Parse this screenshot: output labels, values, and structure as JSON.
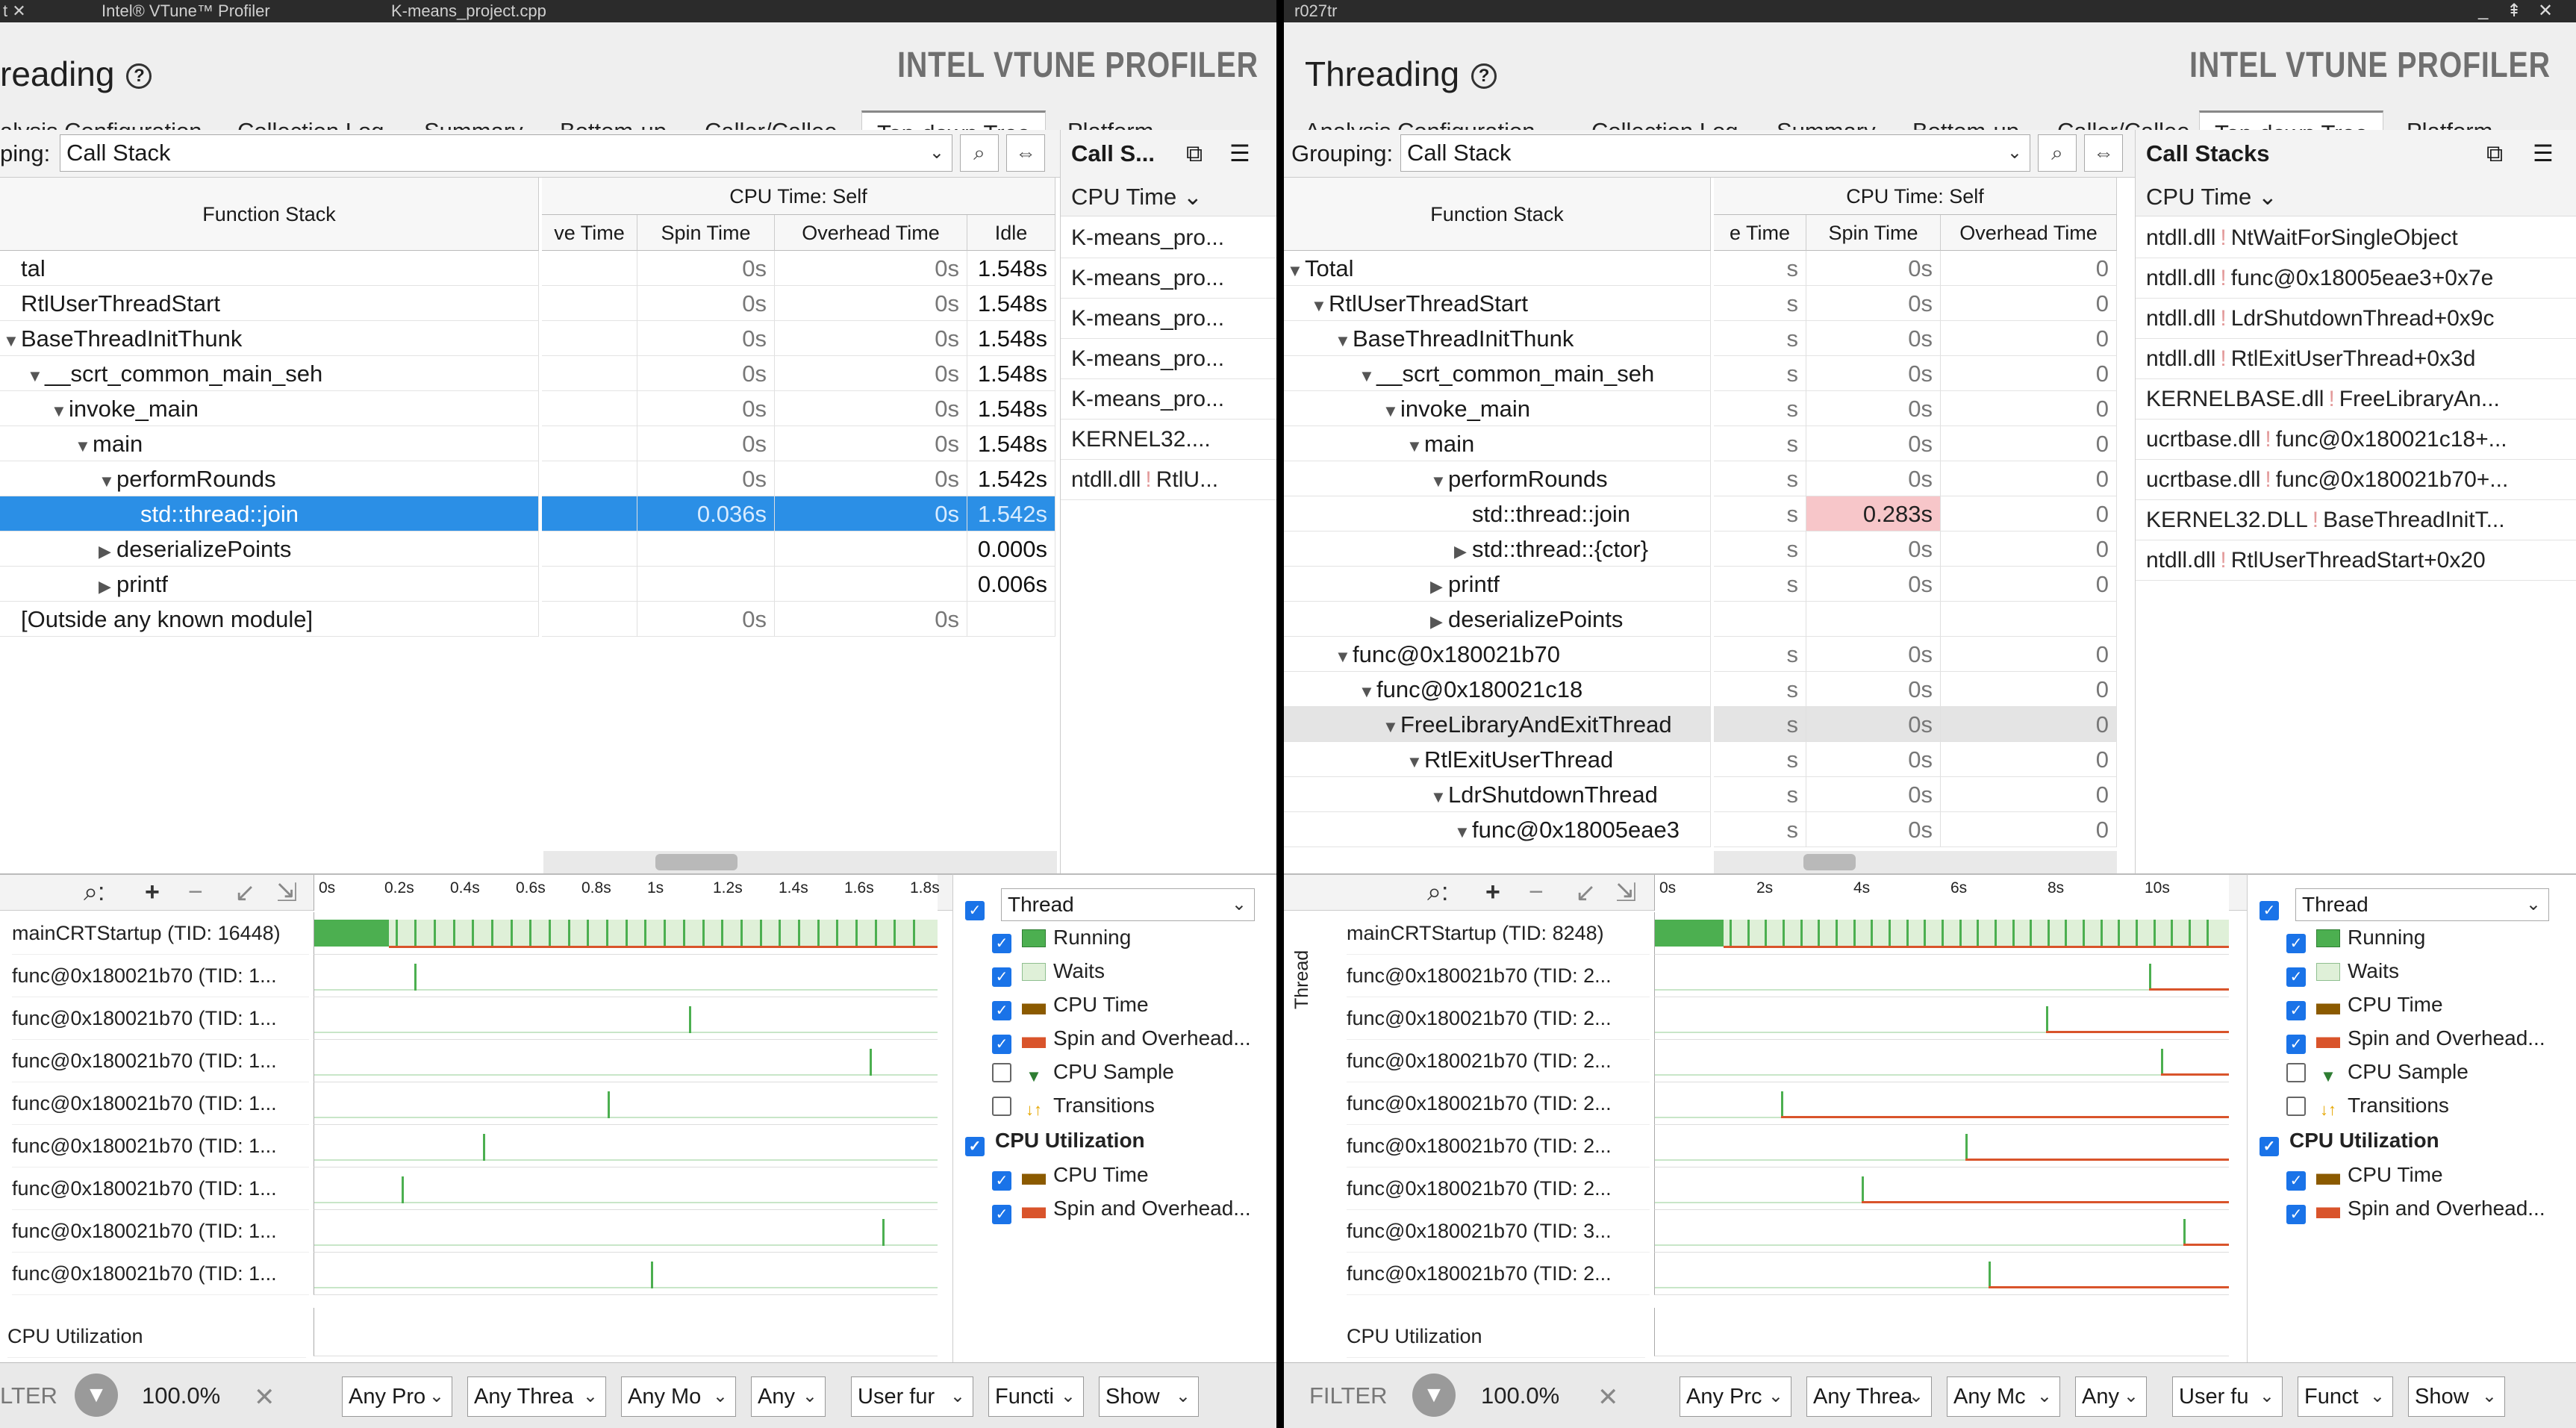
{
  "left": {
    "titlebar": {
      "left_text": "t ✕",
      "tab1": "Intel® VTune™ Profiler",
      "tab2": "K-means_project.cpp"
    },
    "title": "reading",
    "brand": "INTEL VTUNE PROFILER",
    "tabs": [
      "alysis Configuration",
      "Collection Log",
      "Summary",
      "Bottom-up",
      "Caller/Callee",
      "Top-down Tree",
      "Platform"
    ],
    "grouping_label": "ping:",
    "grouping_value": "Call Stack",
    "columns": {
      "function_stack": "Function Stack",
      "cpu_self": "CPU Time: Self",
      "wait_time": "ve Time",
      "spin": "Spin Time",
      "overhead": "Overhead Time",
      "idle": "Idle"
    },
    "rows": [
      {
        "name": "tal",
        "indent": 0,
        "tri": "",
        "wait": "",
        "spin": "0s",
        "overhead": "0s",
        "idle": "1.548s"
      },
      {
        "name": "RtlUserThreadStart",
        "indent": 0,
        "tri": "",
        "wait": "",
        "spin": "0s",
        "overhead": "0s",
        "idle": "1.548s"
      },
      {
        "name": "BaseThreadInitThunk",
        "indent": 0,
        "tri": "▼",
        "wait": "",
        "spin": "0s",
        "overhead": "0s",
        "idle": "1.548s"
      },
      {
        "name": "__scrt_common_main_seh",
        "indent": 1,
        "tri": "▼",
        "wait": "",
        "spin": "0s",
        "overhead": "0s",
        "idle": "1.548s"
      },
      {
        "name": "invoke_main",
        "indent": 2,
        "tri": "▼",
        "wait": "",
        "spin": "0s",
        "overhead": "0s",
        "idle": "1.548s"
      },
      {
        "name": "main",
        "indent": 3,
        "tri": "▼",
        "wait": "",
        "spin": "0s",
        "overhead": "0s",
        "idle": "1.548s"
      },
      {
        "name": "performRounds",
        "indent": 4,
        "tri": "▼",
        "wait": "",
        "spin": "0s",
        "overhead": "0s",
        "idle": "1.542s"
      },
      {
        "name": "std::thread::join",
        "indent": 5,
        "tri": "",
        "wait": "",
        "spin": "0.036s",
        "overhead": "0s",
        "idle": "1.542s",
        "selected": true
      },
      {
        "name": "deserializePoints",
        "indent": 4,
        "tri": "▶",
        "wait": "",
        "spin": "",
        "overhead": "",
        "idle": "0.000s"
      },
      {
        "name": "printf",
        "indent": 4,
        "tri": "▶",
        "wait": "",
        "spin": "",
        "overhead": "",
        "idle": "0.006s"
      },
      {
        "name": "[Outside any known module]",
        "indent": 0,
        "tri": "",
        "wait": "",
        "spin": "0s",
        "overhead": "0s",
        "idle": ""
      }
    ],
    "callstacks": {
      "title": "Call S...",
      "sub": "CPU Time",
      "items": [
        {
          "mod": "K-means_pro...",
          "fn": ""
        },
        {
          "mod": "K-means_pro...",
          "fn": ""
        },
        {
          "mod": "K-means_pro...",
          "fn": ""
        },
        {
          "mod": "K-means_pro...",
          "fn": ""
        },
        {
          "mod": "K-means_pro...",
          "fn": ""
        },
        {
          "mod": "KERNEL32....",
          "fn": ""
        },
        {
          "mod": "ntdll.dll",
          "fn": "RtlU..."
        }
      ]
    },
    "ticks": [
      "0s",
      "0.2s",
      "0.4s",
      "0.6s",
      "0.8s",
      "1s",
      "1.2s",
      "1.4s",
      "1.6s",
      "1.8s"
    ],
    "threads": [
      {
        "label": "mainCRTStartup (TID: 16448)",
        "mark": 0.0
      },
      {
        "label": "func@0x180021b70 (TID: 1...",
        "mark": 0.16
      },
      {
        "label": "func@0x180021b70 (TID: 1...",
        "mark": 0.6
      },
      {
        "label": "func@0x180021b70 (TID: 1...",
        "mark": 0.89
      },
      {
        "label": "func@0x180021b70 (TID: 1...",
        "mark": 0.47
      },
      {
        "label": "func@0x180021b70 (TID: 1...",
        "mark": 0.27
      },
      {
        "label": "func@0x180021b70 (TID: 1...",
        "mark": 0.14
      },
      {
        "label": "func@0x180021b70 (TID: 1...",
        "mark": 0.91
      },
      {
        "label": "func@0x180021b70 (TID: 1...",
        "mark": 0.54
      }
    ],
    "cpu_util_label": "CPU Utilization",
    "legend": {
      "select": "Thread",
      "items": [
        "Running",
        "Waits",
        "CPU Time",
        "Spin and Overhead...",
        "CPU Sample",
        "Transitions"
      ],
      "section": "CPU Utilization",
      "section_items": [
        "CPU Time",
        "Spin and Overhead..."
      ]
    },
    "filter": {
      "label": "LTER",
      "percent": "100.0%",
      "drops": [
        "Any Pro",
        "Any Threa",
        "Any Mo",
        "Any",
        "User fur",
        "Functi",
        "Show"
      ]
    }
  },
  "right": {
    "titlebar": {
      "left_text": "r027tr"
    },
    "title": "Threading",
    "brand": "INTEL VTUNE PROFILER",
    "tabs": [
      "Analysis Configuration",
      "Collection Log",
      "Summary",
      "Bottom-up",
      "Caller/Callee",
      "Top-down Tree",
      "Platform"
    ],
    "grouping_label": "Grouping:",
    "grouping_value": "Call Stack",
    "columns": {
      "function_stack": "Function Stack",
      "cpu_self": "CPU Time: Self",
      "wait_time": "e Time",
      "spin": "Spin Time",
      "overhead": "Overhead Time"
    },
    "rows": [
      {
        "name": "Total",
        "indent": 0,
        "tri": "▼",
        "wait": "s",
        "spin": "0s",
        "overhead": "0"
      },
      {
        "name": "RtlUserThreadStart",
        "indent": 1,
        "tri": "▼",
        "wait": "s",
        "spin": "0s",
        "overhead": "0"
      },
      {
        "name": "BaseThreadInitThunk",
        "indent": 2,
        "tri": "▼",
        "wait": "s",
        "spin": "0s",
        "overhead": "0"
      },
      {
        "name": "__scrt_common_main_seh",
        "indent": 3,
        "tri": "▼",
        "wait": "s",
        "spin": "0s",
        "overhead": "0"
      },
      {
        "name": "invoke_main",
        "indent": 4,
        "tri": "▼",
        "wait": "s",
        "spin": "0s",
        "overhead": "0"
      },
      {
        "name": "main",
        "indent": 5,
        "tri": "▼",
        "wait": "s",
        "spin": "0s",
        "overhead": "0"
      },
      {
        "name": "performRounds",
        "indent": 6,
        "tri": "▼",
        "wait": "s",
        "spin": "0s",
        "overhead": "0"
      },
      {
        "name": "std::thread::join",
        "indent": 7,
        "tri": "",
        "wait": "s",
        "spin": "0.283s",
        "overhead": "0",
        "pink": true
      },
      {
        "name": "std::thread::{ctor}",
        "indent": 7,
        "tri": "▶",
        "wait": "s",
        "spin": "0s",
        "overhead": "0"
      },
      {
        "name": "printf",
        "indent": 6,
        "tri": "▶",
        "wait": "s",
        "spin": "0s",
        "overhead": "0"
      },
      {
        "name": "deserializePoints",
        "indent": 6,
        "tri": "▶",
        "wait": "",
        "spin": "",
        "overhead": ""
      },
      {
        "name": "func@0x180021b70",
        "indent": 2,
        "tri": "▼",
        "wait": "s",
        "spin": "0s",
        "overhead": "0"
      },
      {
        "name": "func@0x180021c18",
        "indent": 3,
        "tri": "▼",
        "wait": "s",
        "spin": "0s",
        "overhead": "0"
      },
      {
        "name": "FreeLibraryAndExitThread",
        "indent": 4,
        "tri": "▼",
        "wait": "s",
        "spin": "0s",
        "overhead": "0",
        "highlight": true
      },
      {
        "name": "RtlExitUserThread",
        "indent": 5,
        "tri": "▼",
        "wait": "s",
        "spin": "0s",
        "overhead": "0"
      },
      {
        "name": "LdrShutdownThread",
        "indent": 6,
        "tri": "▼",
        "wait": "s",
        "spin": "0s",
        "overhead": "0"
      },
      {
        "name": "func@0x18005eae3",
        "indent": 7,
        "tri": "▼",
        "wait": "s",
        "spin": "0s",
        "overhead": "0"
      }
    ],
    "callstacks": {
      "title": "Call Stacks",
      "sub": "CPU Time",
      "items": [
        {
          "mod": "ntdll.dll",
          "fn": "NtWaitForSingleObject"
        },
        {
          "mod": "ntdll.dll",
          "fn": "func@0x18005eae3+0x7e"
        },
        {
          "mod": "ntdll.dll",
          "fn": "LdrShutdownThread+0x9c"
        },
        {
          "mod": "ntdll.dll",
          "fn": "RtlExitUserThread+0x3d"
        },
        {
          "mod": "KERNELBASE.dll",
          "fn": "FreeLibraryAn..."
        },
        {
          "mod": "ucrtbase.dll",
          "fn": "func@0x180021c18+..."
        },
        {
          "mod": "ucrtbase.dll",
          "fn": "func@0x180021b70+..."
        },
        {
          "mod": "KERNEL32.DLL",
          "fn": "BaseThreadInitT..."
        },
        {
          "mod": "ntdll.dll",
          "fn": "RtlUserThreadStart+0x20"
        }
      ]
    },
    "ticks": [
      "0s",
      "2s",
      "4s",
      "6s",
      "8s",
      "10s"
    ],
    "threads": [
      {
        "label": "mainCRTStartup (TID: 8248)",
        "mark": 0.0
      },
      {
        "label": "func@0x180021b70 (TID: 2...",
        "mark": 0.86
      },
      {
        "label": "func@0x180021b70 (TID: 2...",
        "mark": 0.68
      },
      {
        "label": "func@0x180021b70 (TID: 2...",
        "mark": 0.88
      },
      {
        "label": "func@0x180021b70 (TID: 2...",
        "mark": 0.22
      },
      {
        "label": "func@0x180021b70 (TID: 2...",
        "mark": 0.54
      },
      {
        "label": "func@0x180021b70 (TID: 2...",
        "mark": 0.36
      },
      {
        "label": "func@0x180021b70 (TID: 3...",
        "mark": 0.92
      },
      {
        "label": "func@0x180021b70 (TID: 2...",
        "mark": 0.58
      }
    ],
    "thread_axis": "Thread",
    "cpu_util_label": "CPU Utilization",
    "legend": {
      "select": "Thread",
      "items": [
        "Running",
        "Waits",
        "CPU Time",
        "Spin and Overhead...",
        "CPU Sample",
        "Transitions"
      ],
      "section": "CPU Utilization",
      "section_items": [
        "CPU Time",
        "Spin and Overhead..."
      ]
    },
    "filter": {
      "label": "FILTER",
      "percent": "100.0%",
      "drops": [
        "Any Prc",
        "Any Threa",
        "Any Mc",
        "Any",
        "User fu",
        "Funct",
        "Show"
      ]
    }
  },
  "colors": {
    "running": "#4caf50",
    "waits": "#dff0d8",
    "spin": "#d9542b",
    "cpu": "#8b5a00",
    "selected": "#2b8fe6",
    "pink": "#f7c6c9"
  }
}
